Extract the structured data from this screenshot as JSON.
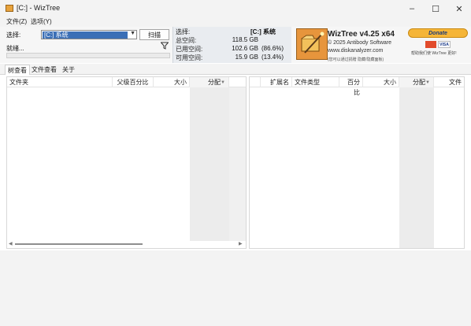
{
  "window": {
    "title": "[C:] - WizTree",
    "minimize": "–",
    "maximize": "☐",
    "close": "✕"
  },
  "menu": {
    "file": "文件(Z)",
    "options": "选项(Y)"
  },
  "toolbar": {
    "select_label": "选择:",
    "drive_value": "[C:] 系统",
    "scan_label": "扫描",
    "status_text": "就绪..."
  },
  "stats": {
    "selection_label": "选择:",
    "selection_value": "[C:]  系统",
    "total_label": "总空间:",
    "total_value": "118.5 GB",
    "used_label": "已用空间:",
    "used_value": "102.6 GB",
    "used_pct": "(86.6%)",
    "free_label": "可用空间:",
    "free_value": "15.9 GB",
    "free_pct": "(13.4%)"
  },
  "brand": {
    "name": "WizTree v4.25 x64",
    "copyright": "© 2025 Antibody Software",
    "url": "www.diskanalyzer.com",
    "note": "(您可以通过捐赠 隐藏/隐藏面板)"
  },
  "donate": {
    "label": "Donate",
    "visa": "VISA",
    "note": "帮助我们使 WizTree 更好!"
  },
  "tabs": [
    {
      "label": "树查看"
    },
    {
      "label": "文件查看"
    },
    {
      "label": "关于"
    }
  ],
  "tree_columns": {
    "folder": "文件夹",
    "parent_pct": "父级百分比",
    "size": "大小",
    "allocated": "分配"
  },
  "ext_columns": {
    "ext": "扩展名",
    "type": "文件类型",
    "pct": "百分比",
    "size": "大小",
    "allocated": "分配",
    "files": "文件"
  },
  "colors": {
    "accent": "#3b6fb6",
    "logo": "#e7953c",
    "donate": "#f5b538"
  }
}
